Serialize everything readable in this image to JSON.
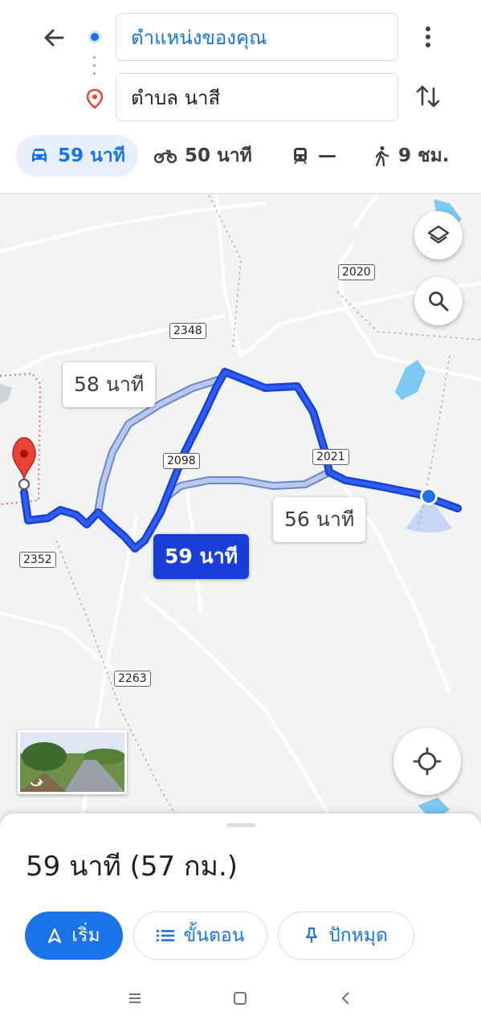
{
  "search": {
    "origin": "ตำแหน่งของคุณ",
    "destination": "ตำบล นาสี"
  },
  "modes": {
    "car": "59 นาที",
    "bike": "50 นาที",
    "transit": "—",
    "walk": "9 ชม."
  },
  "map": {
    "shields": [
      "2020",
      "2348",
      "2098",
      "2021",
      "2352",
      "2263"
    ],
    "route_labels": {
      "alt1": "58 นาที",
      "primary": "59 นาที",
      "alt2": "56 นาที"
    }
  },
  "sheet": {
    "summary": "59 นาที (57 กม.)",
    "start": "เริ่ม",
    "steps": "ขั้นตอน",
    "pin": "ปักหมุด"
  },
  "colors": {
    "accent": "#1a73e8",
    "route_primary": "#1a3ed8",
    "route_alt": "#a7bdf0",
    "pin": "#ea4335"
  }
}
